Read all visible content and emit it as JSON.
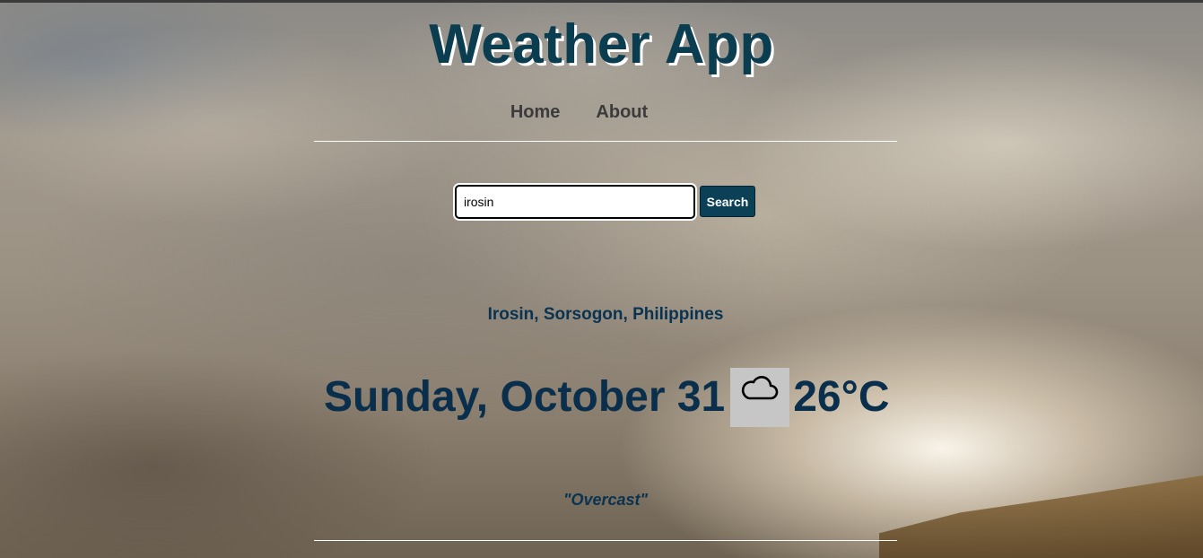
{
  "app": {
    "title": "Weather App"
  },
  "nav": {
    "items": [
      {
        "label": "Home"
      },
      {
        "label": "About"
      }
    ]
  },
  "search": {
    "value": "irosin",
    "button_label": "Search"
  },
  "weather": {
    "location": "Irosin, Sorsogon, Philippines",
    "date": "Sunday, October 31",
    "icon": "cloud-icon",
    "temperature": "26°C",
    "description": "\"Overcast\""
  },
  "colors": {
    "title": "#0b3d50",
    "accent": "#0b4057",
    "text": "#0a2f4c",
    "nav_text": "#3b3b3b",
    "icon_bg": "#c6c6c6"
  }
}
